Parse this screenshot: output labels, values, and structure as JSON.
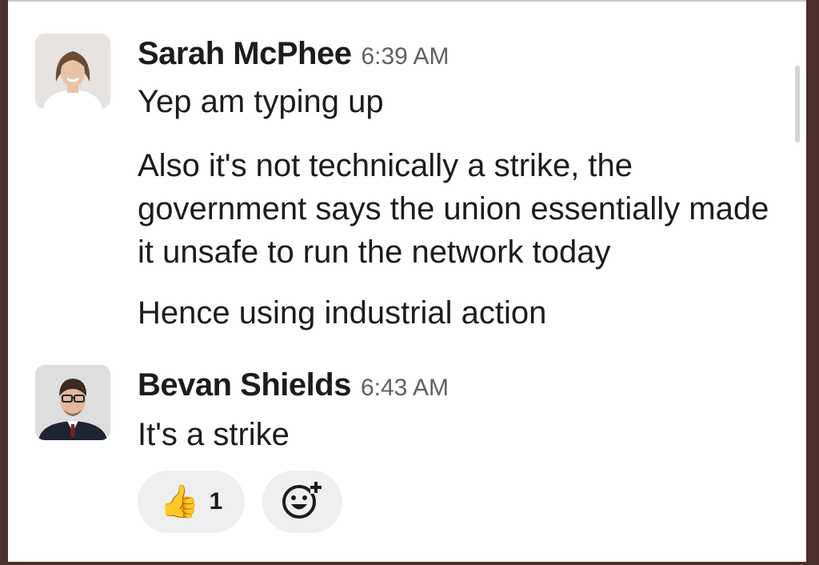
{
  "messages": [
    {
      "author": "Sarah McPhee",
      "time": "6:39 AM",
      "avatar_icon": "person-avatar-woman",
      "paragraphs": [
        "Yep am typing up",
        "Also it's not technically a strike, the government says the union essentially made it unsafe to run the network today",
        "Hence using industrial action"
      ]
    },
    {
      "author": "Bevan Shields",
      "time": "6:43 AM",
      "avatar_icon": "person-avatar-man",
      "paragraphs": [
        "It's a strike"
      ],
      "reactions": [
        {
          "emoji": "👍",
          "icon": "thumbs-up-icon",
          "count": "1"
        }
      ],
      "add_reaction_icon": "add-reaction-icon"
    }
  ]
}
